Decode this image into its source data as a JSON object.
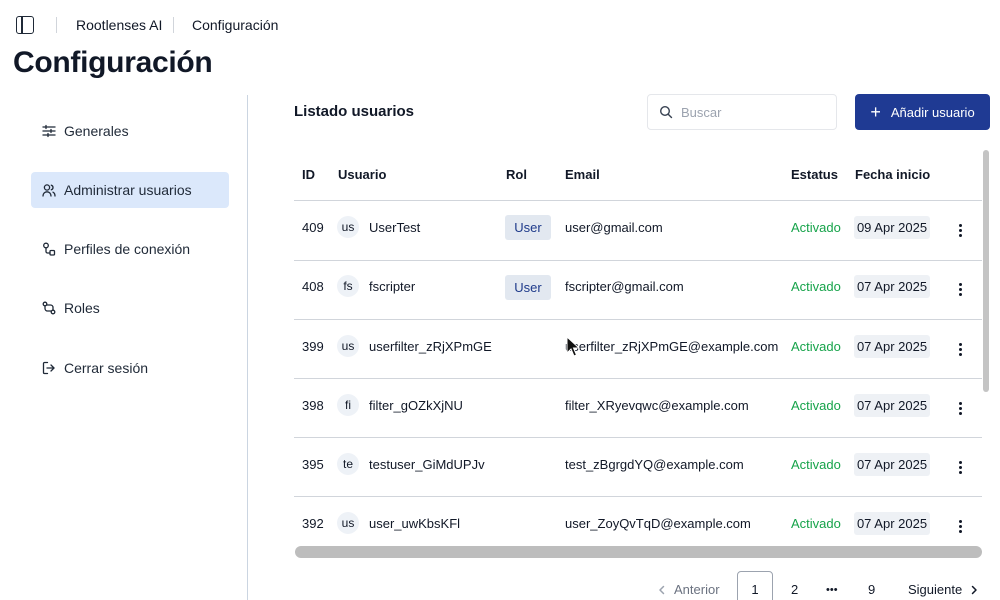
{
  "breadcrumb": {
    "app": "Rootlenses AI",
    "page": "Configuración"
  },
  "page_title": "Configuración",
  "sidebar": {
    "items": [
      {
        "label": "Generales",
        "icon": "sliders-icon",
        "active": false
      },
      {
        "label": "Administrar usuarios",
        "icon": "users-icon",
        "active": true
      },
      {
        "label": "Perfiles de conexión",
        "icon": "connection-icon",
        "active": false
      },
      {
        "label": "Roles",
        "icon": "route-icon",
        "active": false
      },
      {
        "label": "Cerrar sesión",
        "icon": "logout-icon",
        "active": false
      }
    ]
  },
  "main": {
    "title": "Listado usuarios",
    "search_placeholder": "Buscar",
    "add_label": "Añadir usuario"
  },
  "table": {
    "headers": [
      "ID",
      "Usuario",
      "Rol",
      "Email",
      "Estatus",
      "Fecha inicio"
    ],
    "rows": [
      {
        "id": "409",
        "initials": "us",
        "user": "UserTest",
        "role": "User",
        "email": "user@gmail.com",
        "status": "Activado",
        "date": "09 Apr 2025"
      },
      {
        "id": "408",
        "initials": "fs",
        "user": "fscripter",
        "role": "User",
        "email": "fscripter@gmail.com",
        "status": "Activado",
        "date": "07 Apr 2025"
      },
      {
        "id": "399",
        "initials": "us",
        "user": "userfilter_zRjXPmGE",
        "role": "",
        "email": "userfilter_zRjXPmGE@example.com",
        "status": "Activado",
        "date": "07 Apr 2025"
      },
      {
        "id": "398",
        "initials": "fi",
        "user": "filter_gOZkXjNU",
        "role": "",
        "email": "filter_XRyevqwc@example.com",
        "status": "Activado",
        "date": "07 Apr 2025"
      },
      {
        "id": "395",
        "initials": "te",
        "user": "testuser_GiMdUPJv",
        "role": "",
        "email": "test_zBgrgdYQ@example.com",
        "status": "Activado",
        "date": "07 Apr 2025"
      },
      {
        "id": "392",
        "initials": "us",
        "user": "user_uwKbsKFl",
        "role": "",
        "email": "user_ZoyQvTqD@example.com",
        "status": "Activado",
        "date": "07 Apr 2025"
      }
    ]
  },
  "pagination": {
    "prev_label": "Anterior",
    "pages": [
      "1",
      "2",
      "9"
    ],
    "current": "1",
    "ellipsis": "•••",
    "next_label": "Siguiente"
  },
  "colors": {
    "accent": "#1f3a93",
    "active_bg": "#dbe8fb",
    "status_green": "#16a34a",
    "role_text": "#1e3a8a"
  }
}
